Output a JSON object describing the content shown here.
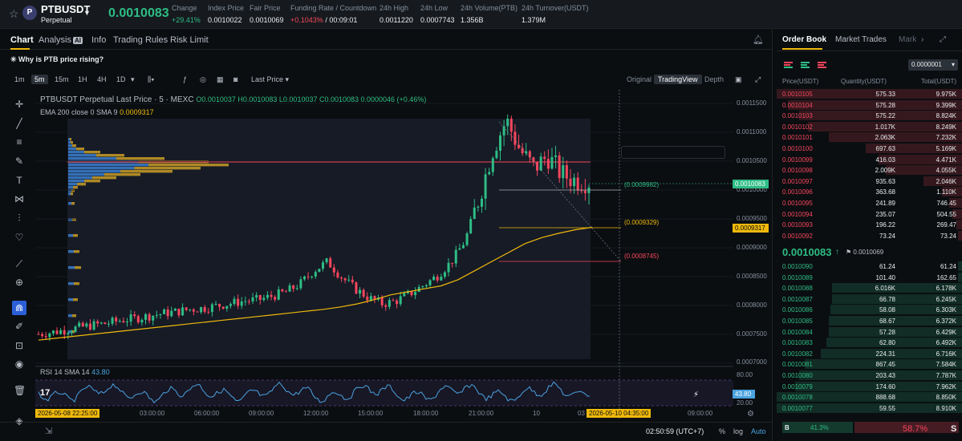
{
  "header": {
    "symbol": "PTBUSDT",
    "market": "Perpetual",
    "coin_letter": "P",
    "last_price": "0.0010083",
    "stats": [
      {
        "label": "Change",
        "value": "+29.41%",
        "tone": "green"
      },
      {
        "label": "Index Price",
        "value": "0.0010022",
        "tone": ""
      },
      {
        "label": "Fair Price",
        "value": "0.0010069",
        "tone": ""
      },
      {
        "label": "Funding Rate / Countdown",
        "value_a": "+0.1043%",
        "value_b": "/ 00:09:01"
      },
      {
        "label": "24h High",
        "value": "0.0011220",
        "tone": ""
      },
      {
        "label": "24h Low",
        "value": "0.0007743",
        "tone": ""
      },
      {
        "label": "24h Volume(PTB)",
        "value": "1.356B",
        "tone": ""
      },
      {
        "label": "24h Turnover(USDT)",
        "value": "1.379M",
        "tone": ""
      }
    ]
  },
  "tabs": {
    "chart": "Chart",
    "analysis": "Analysis",
    "analysis_badge": "AI",
    "info": "Info",
    "trading_rules": "Trading Rules",
    "risk_limit": "Risk Limit"
  },
  "banner": "Why is PTB price rising?",
  "toolbar": {
    "timeframes": [
      "1m",
      "5m",
      "15m",
      "1H",
      "4H",
      "1D"
    ],
    "active_timeframe": "5m",
    "price_type": "Last Price",
    "views": [
      "Original",
      "TradingView",
      "Depth"
    ],
    "active_view": "TradingView"
  },
  "legend": {
    "title": "PTBUSDT Perpetual Last Price · 5 · MEXC",
    "ohlc": "O0.0010037 H0.0010083 L0.0010037 C0.0010083 0.0000046 (+0.46%)",
    "ema_label": "EMA 200 close 0 SMA 9",
    "ema_value": "0.0009317",
    "rsi_label": "RSI 14 SMA 14",
    "rsi_value": "43.80"
  },
  "axis": {
    "y_ticks": [
      "0.0011500",
      "0.0011000",
      "0.0010500",
      "0.0010000",
      "0.0009500",
      "0.0009000",
      "0.0008500",
      "0.0008000",
      "0.0007500",
      "0.0007000"
    ],
    "x_ticks": [
      "03:00:00",
      "06:00:00",
      "09:00:00",
      "12:00:00",
      "15:00:00",
      "18:00:00",
      "21:00:00",
      "10",
      "03",
      "09:00:00"
    ],
    "x_start_badge": "2026-05-08   22:25:00",
    "x_cursor_badge": "2026-05-10   04:35:00",
    "rsi_ticks": [
      "80.00",
      "20.00"
    ],
    "rsi_badge": "43.80",
    "price_badge": "0.0010083",
    "ema_badge": "0.0009317"
  },
  "levels": {
    "upper": "(0.0009982)",
    "middle": "(0.0009329)",
    "lower": "(0.0008745)"
  },
  "chart_data": {
    "type": "candlestick",
    "title": "PTBUSDT Perpetual Last Price · 5 · MEXC",
    "ylim": [
      0.0007,
      0.00116
    ],
    "series": [
      {
        "name": "Price",
        "values": [
          0.000755,
          0.000758,
          0.000762,
          0.000766,
          0.00077,
          0.000773,
          0.000778,
          0.000781,
          0.000785,
          0.000789,
          0.000792,
          0.000796,
          0.000798,
          0.000802,
          0.000806,
          0.00081,
          0.000812,
          0.000818,
          0.000825,
          0.000838,
          0.00086,
          0.000875,
          0.00085,
          0.00083,
          0.000815,
          0.000805,
          0.00081,
          0.000822,
          0.000836,
          0.000852,
          0.000875,
          0.00091,
          0.00098,
          0.00106,
          0.00111,
          0.00106,
          0.00103,
          0.00105,
          0.00102,
          0.00101,
          0.001008
        ]
      },
      {
        "name": "EMA 200",
        "values": [
          0.000745,
          0.000748,
          0.000751,
          0.000754,
          0.000757,
          0.00076,
          0.000763,
          0.000766,
          0.000769,
          0.000772,
          0.000775,
          0.000778,
          0.000781,
          0.000784,
          0.000787,
          0.00079,
          0.000793,
          0.000796,
          0.0008,
          0.000805,
          0.000812,
          0.00082,
          0.000825,
          0.00083,
          0.000835,
          0.000845,
          0.00086,
          0.000875,
          0.00089,
          0.000905,
          0.000915,
          0.000922,
          0.000928,
          0.000932
        ]
      }
    ]
  },
  "bottom": {
    "clock": "02:50:59 (UTC+7)",
    "percent": "%",
    "log": "log",
    "auto": "Auto"
  },
  "orderbook": {
    "tabs": [
      "Order Book",
      "Market Trades",
      "Mark"
    ],
    "precision": "0.0000001",
    "headers": [
      "Price(USDT)",
      "Quantity(USDT)",
      "Total(USDT)"
    ],
    "asks": [
      {
        "price": "0.0010105",
        "qty": "575.33",
        "total": "9.975K",
        "depth": 1.0
      },
      {
        "price": "0.0010104",
        "qty": "575.28",
        "total": "9.399K",
        "depth": 0.94
      },
      {
        "price": "0.0010103",
        "qty": "575.22",
        "total": "8.824K",
        "depth": 0.88
      },
      {
        "price": "0.0010102",
        "qty": "1.017K",
        "total": "8.249K",
        "depth": 0.83
      },
      {
        "price": "0.0010101",
        "qty": "2.063K",
        "total": "7.232K",
        "depth": 0.72
      },
      {
        "price": "0.0010100",
        "qty": "697.63",
        "total": "5.169K",
        "depth": 0.52
      },
      {
        "price": "0.0010099",
        "qty": "416.03",
        "total": "4.471K",
        "depth": 0.45
      },
      {
        "price": "0.0010098",
        "qty": "2.009K",
        "total": "4.055K",
        "depth": 0.41
      },
      {
        "price": "0.0010097",
        "qty": "935.63",
        "total": "2.046K",
        "depth": 0.21
      },
      {
        "price": "0.0010096",
        "qty": "363.68",
        "total": "1.110K",
        "depth": 0.11
      },
      {
        "price": "0.0010095",
        "qty": "241.89",
        "total": "746.45",
        "depth": 0.07
      },
      {
        "price": "0.0010094",
        "qty": "235.07",
        "total": "504.55",
        "depth": 0.05
      },
      {
        "price": "0.0010093",
        "qty": "196.22",
        "total": "269.47",
        "depth": 0.03
      },
      {
        "price": "0.0010092",
        "qty": "73.24",
        "total": "73.24",
        "depth": 0.01
      }
    ],
    "mid_price": "0.0010083",
    "mid_arrow": "↑",
    "mark_price": "0.0010069",
    "bids": [
      {
        "price": "0.0010090",
        "qty": "61.24",
        "total": "61.24",
        "depth": 0.01
      },
      {
        "price": "0.0010089",
        "qty": "101.40",
        "total": "162.65",
        "depth": 0.02
      },
      {
        "price": "0.0010088",
        "qty": "6.016K",
        "total": "6.178K",
        "depth": 0.7
      },
      {
        "price": "0.0010087",
        "qty": "66.78",
        "total": "6.245K",
        "depth": 0.7
      },
      {
        "price": "0.0010086",
        "qty": "58.08",
        "total": "6.303K",
        "depth": 0.71
      },
      {
        "price": "0.0010085",
        "qty": "68.67",
        "total": "6.372K",
        "depth": 0.72
      },
      {
        "price": "0.0010084",
        "qty": "57.28",
        "total": "6.429K",
        "depth": 0.72
      },
      {
        "price": "0.0010083",
        "qty": "62.80",
        "total": "6.492K",
        "depth": 0.73
      },
      {
        "price": "0.0010082",
        "qty": "224.31",
        "total": "6.716K",
        "depth": 0.76
      },
      {
        "price": "0.0010081",
        "qty": "867.45",
        "total": "7.584K",
        "depth": 0.85
      },
      {
        "price": "0.0010080",
        "qty": "203.43",
        "total": "7.787K",
        "depth": 0.88
      },
      {
        "price": "0.0010079",
        "qty": "174.60",
        "total": "7.962K",
        "depth": 0.9
      },
      {
        "price": "0.0010078",
        "qty": "888.68",
        "total": "8.850K",
        "depth": 1.0
      },
      {
        "price": "0.0010077",
        "qty": "59.55",
        "total": "8.910K",
        "depth": 1.0
      }
    ],
    "buy_label": "B",
    "buy_pct": "41.3%",
    "sell_pct": "58.7%",
    "sell_label": "S"
  }
}
